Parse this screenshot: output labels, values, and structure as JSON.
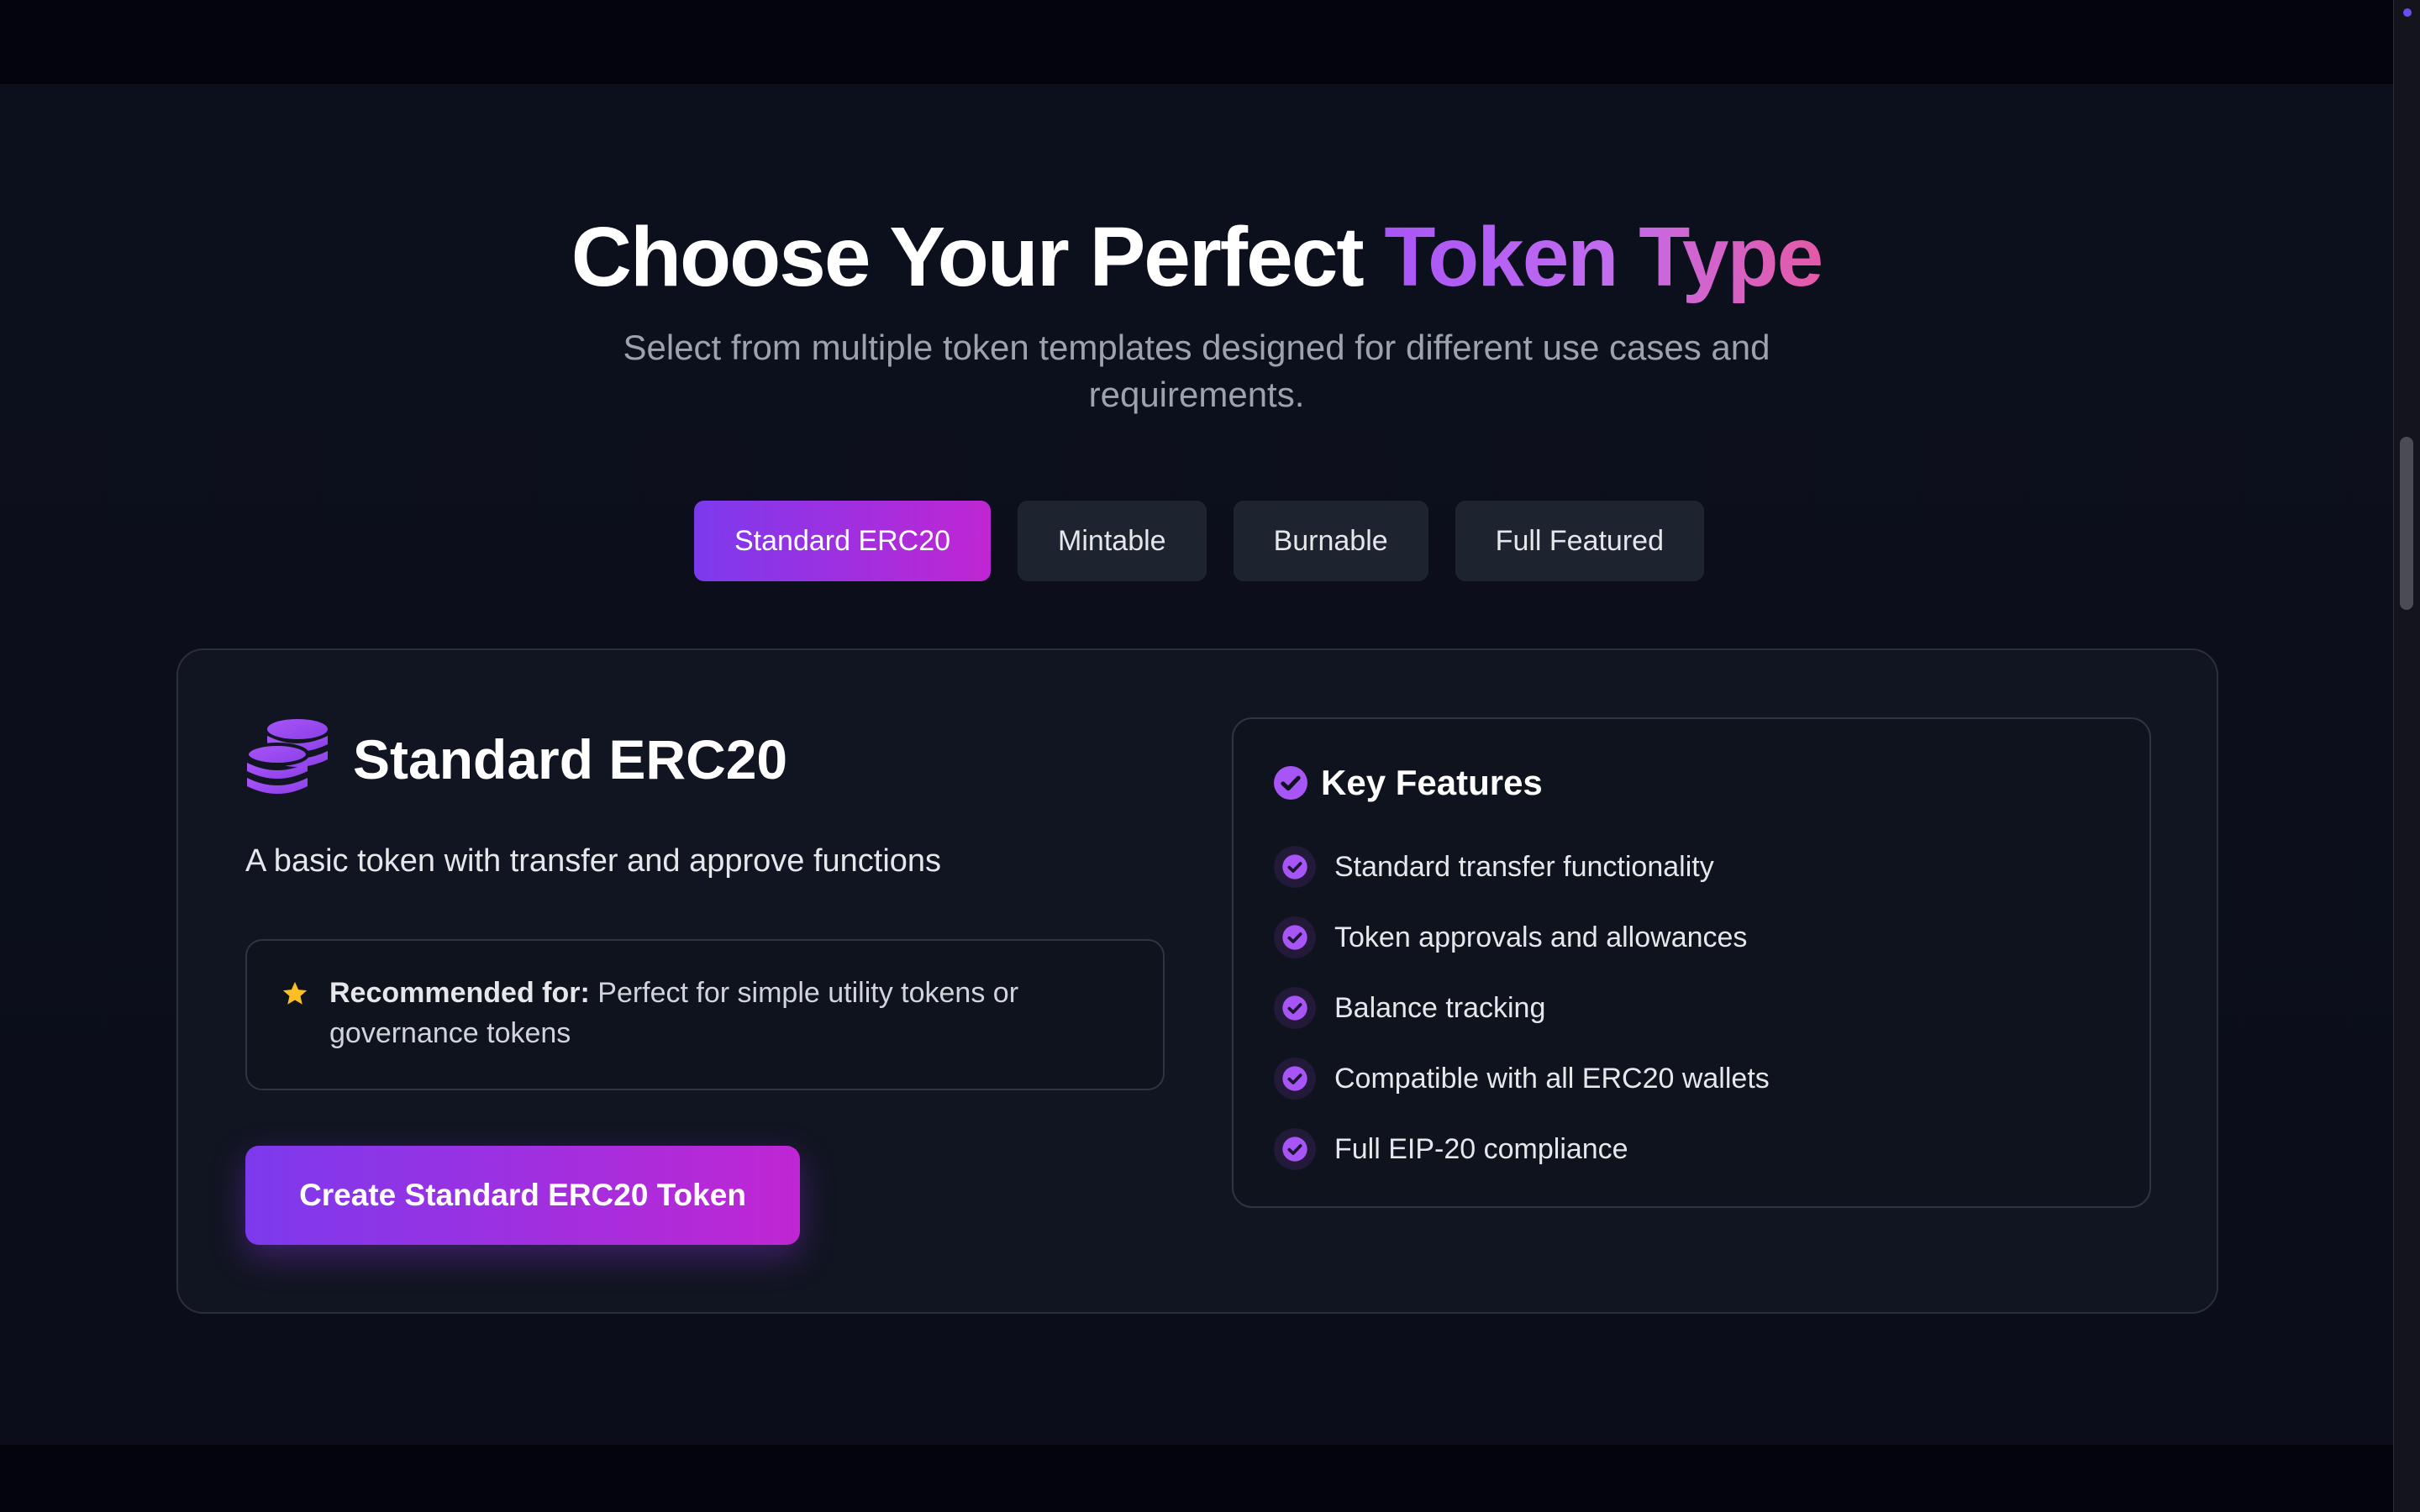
{
  "colors": {
    "accent_start": "#7c3aed",
    "accent_end": "#c026d3",
    "background": "#0b0e1a",
    "card": "#111521",
    "tab_inactive": "#1e2330",
    "star": "#fbbf24"
  },
  "hero": {
    "title_plain": "Choose Your Perfect ",
    "title_highlight": "Token Type",
    "subtitle": "Select from multiple token templates designed for different use cases and requirements."
  },
  "tabs": [
    {
      "label": "Standard ERC20",
      "active": true
    },
    {
      "label": "Mintable",
      "active": false
    },
    {
      "label": "Burnable",
      "active": false
    },
    {
      "label": "Full Featured",
      "active": false
    }
  ],
  "card": {
    "icon": "coins-icon",
    "title": "Standard ERC20",
    "description": "A basic token with transfer and approve functions",
    "recommendation": {
      "icon": "star-icon",
      "label": "Recommended for:",
      "text": " Perfect for simple utility tokens or governance tokens"
    },
    "cta_label": "Create Standard ERC20 Token",
    "features": {
      "icon": "check-circle-icon",
      "title": "Key Features",
      "items": [
        "Standard transfer functionality",
        "Token approvals and allowances",
        "Balance tracking",
        "Compatible with all ERC20 wallets",
        "Full EIP-20 compliance"
      ]
    }
  }
}
